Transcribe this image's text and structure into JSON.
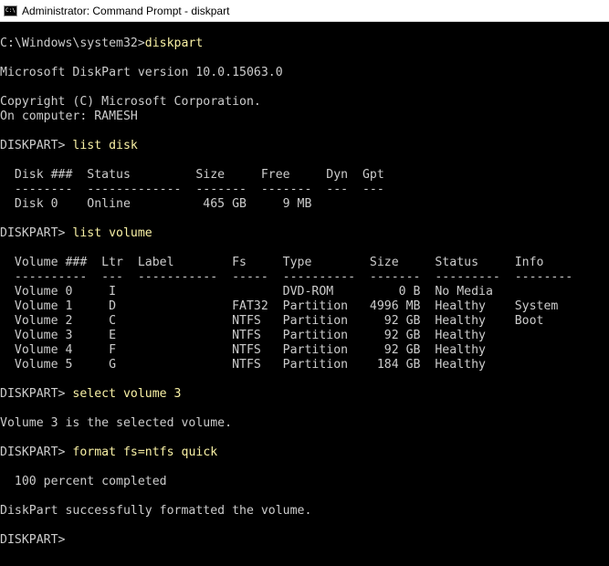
{
  "window": {
    "title": "Administrator: Command Prompt - diskpart",
    "icon": "cmd-icon",
    "icon_text": "C:\\"
  },
  "console": {
    "lines": [
      {
        "prompt": "C:\\Windows\\system32>",
        "cmd": "diskpart"
      },
      {
        "text": ""
      },
      {
        "text": "Microsoft DiskPart version 10.0.15063.0"
      },
      {
        "text": ""
      },
      {
        "text": "Copyright (C) Microsoft Corporation."
      },
      {
        "text": "On computer: RAMESH"
      },
      {
        "text": ""
      },
      {
        "prompt": "DISKPART> ",
        "cmd": "list disk"
      },
      {
        "text": ""
      },
      {
        "text": "  Disk ###  Status         Size     Free     Dyn  Gpt"
      },
      {
        "text": "  --------  -------------  -------  -------  ---  ---"
      },
      {
        "text": "  Disk 0    Online          465 GB     9 MB"
      },
      {
        "text": ""
      },
      {
        "prompt": "DISKPART> ",
        "cmd": "list volume"
      },
      {
        "text": ""
      },
      {
        "text": "  Volume ###  Ltr  Label        Fs     Type        Size     Status     Info"
      },
      {
        "text": "  ----------  ---  -----------  -----  ----------  -------  ---------  --------"
      },
      {
        "text": "  Volume 0     I                       DVD-ROM         0 B  No Media"
      },
      {
        "text": "  Volume 1     D                FAT32  Partition   4996 MB  Healthy    System"
      },
      {
        "text": "  Volume 2     C                NTFS   Partition     92 GB  Healthy    Boot"
      },
      {
        "text": "  Volume 3     E                NTFS   Partition     92 GB  Healthy"
      },
      {
        "text": "  Volume 4     F                NTFS   Partition     92 GB  Healthy"
      },
      {
        "text": "  Volume 5     G                NTFS   Partition    184 GB  Healthy"
      },
      {
        "text": ""
      },
      {
        "prompt": "DISKPART> ",
        "cmd": "select volume 3"
      },
      {
        "text": ""
      },
      {
        "text": "Volume 3 is the selected volume."
      },
      {
        "text": ""
      },
      {
        "prompt": "DISKPART> ",
        "cmd": "format fs=ntfs quick"
      },
      {
        "text": ""
      },
      {
        "text": "  100 percent completed"
      },
      {
        "text": ""
      },
      {
        "text": "DiskPart successfully formatted the volume."
      },
      {
        "text": ""
      },
      {
        "prompt": "DISKPART> ",
        "cmd": ""
      }
    ]
  },
  "colors": {
    "background": "#000000",
    "text": "#cccccc",
    "command": "#f9f1a5"
  }
}
